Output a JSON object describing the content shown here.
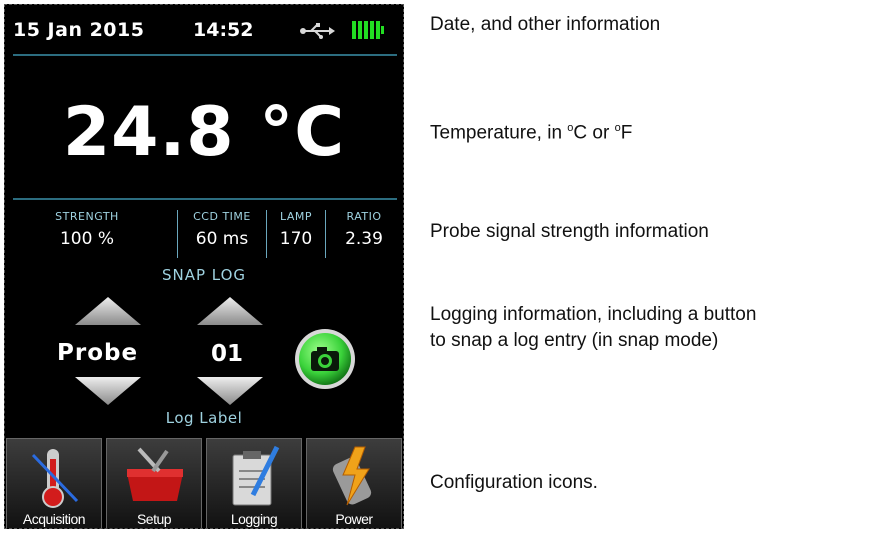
{
  "status": {
    "date": "15 Jan 2015",
    "time": "14:52",
    "usb_icon": "usb-icon",
    "battery_icon": "battery-icon",
    "battery_color": "#22dd22"
  },
  "reading": {
    "temperature": "24.8 °C"
  },
  "signal": {
    "strength_label": "STRENGTH",
    "strength_value": "100 %",
    "ccd_label": "CCD TIME",
    "ccd_value": "60 ms",
    "lamp_label": "LAMP",
    "lamp_value": "170",
    "ratio_label": "RATIO",
    "ratio_value": "2.39"
  },
  "logging": {
    "mode_label": "SNAP LOG",
    "label_value": "Probe",
    "number_value": "01",
    "footer_label": "Log Label",
    "snap_icon": "camera-icon",
    "snap_color": "#3bd33b"
  },
  "toolbar": {
    "items": [
      {
        "label": "Acquisition",
        "icon": "thermometer-icon"
      },
      {
        "label": "Setup",
        "icon": "toolbox-icon"
      },
      {
        "label": "Logging",
        "icon": "clipboard-icon"
      },
      {
        "label": "Power",
        "icon": "battery-bolt-icon"
      }
    ]
  },
  "annotations": {
    "date_info": "Date, and other information",
    "temp_info_prefix": "Temperature, in ",
    "temp_info_unit_c": "C",
    "temp_info_or": " or ",
    "temp_info_unit_f": "F",
    "degree": "o",
    "signal_info": "Probe signal strength information",
    "logging_info_line1": "Logging information, including a button",
    "logging_info_line2": "to snap a log entry (in snap mode)",
    "config_info": "Configuration icons."
  }
}
